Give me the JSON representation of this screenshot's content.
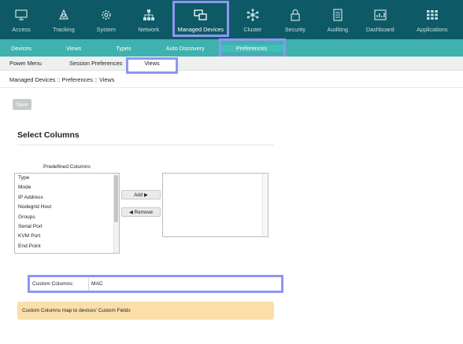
{
  "topnav": {
    "items": [
      {
        "label": "Access",
        "icon": "monitor-icon"
      },
      {
        "label": "Tracking",
        "icon": "tracking-icon"
      },
      {
        "label": "System",
        "icon": "gear-icon"
      },
      {
        "label": "Network",
        "icon": "network-icon"
      },
      {
        "label": "Managed Devices",
        "icon": "devices-icon",
        "active": true
      },
      {
        "label": "Cluster",
        "icon": "cluster-icon"
      },
      {
        "label": "Security",
        "icon": "lock-icon"
      },
      {
        "label": "Auditing",
        "icon": "document-icon"
      },
      {
        "label": "Dashboard",
        "icon": "chart-icon"
      },
      {
        "label": "Applications",
        "icon": "apps-grid-icon"
      }
    ]
  },
  "subnav": {
    "items": [
      {
        "label": "Devices"
      },
      {
        "label": "Views"
      },
      {
        "label": "Types"
      },
      {
        "label": "Auto Discovery"
      },
      {
        "label": "Preferences",
        "active": true
      }
    ]
  },
  "tertnav": {
    "items": [
      {
        "label": "Power Menu"
      },
      {
        "label": "Session Preferences"
      },
      {
        "label": "Views",
        "active": true
      }
    ]
  },
  "breadcrumb": "Managed Devices :: Preferences :: Views",
  "save_label": "Save",
  "section_title": "Select Columns",
  "predefined": {
    "label": "Predefined Columns",
    "options": [
      "Type",
      "Mode",
      "IP Address",
      "Nodegrid Host",
      "Groups",
      "Serial Port",
      "KVM Port",
      "End Point"
    ]
  },
  "add_label": "Add ▶",
  "remove_label": "◀ Remove",
  "selected_columns": [],
  "custom_columns": {
    "label": "Custom Columns:",
    "value": "MAC"
  },
  "info_text": "Custom Columns map to devices' Custom Fields",
  "colors": {
    "nav_bg": "#0e5966",
    "subnav_bg": "#3fb1ae",
    "highlight": "#8d97f0",
    "info_bg": "#fadfaa"
  }
}
